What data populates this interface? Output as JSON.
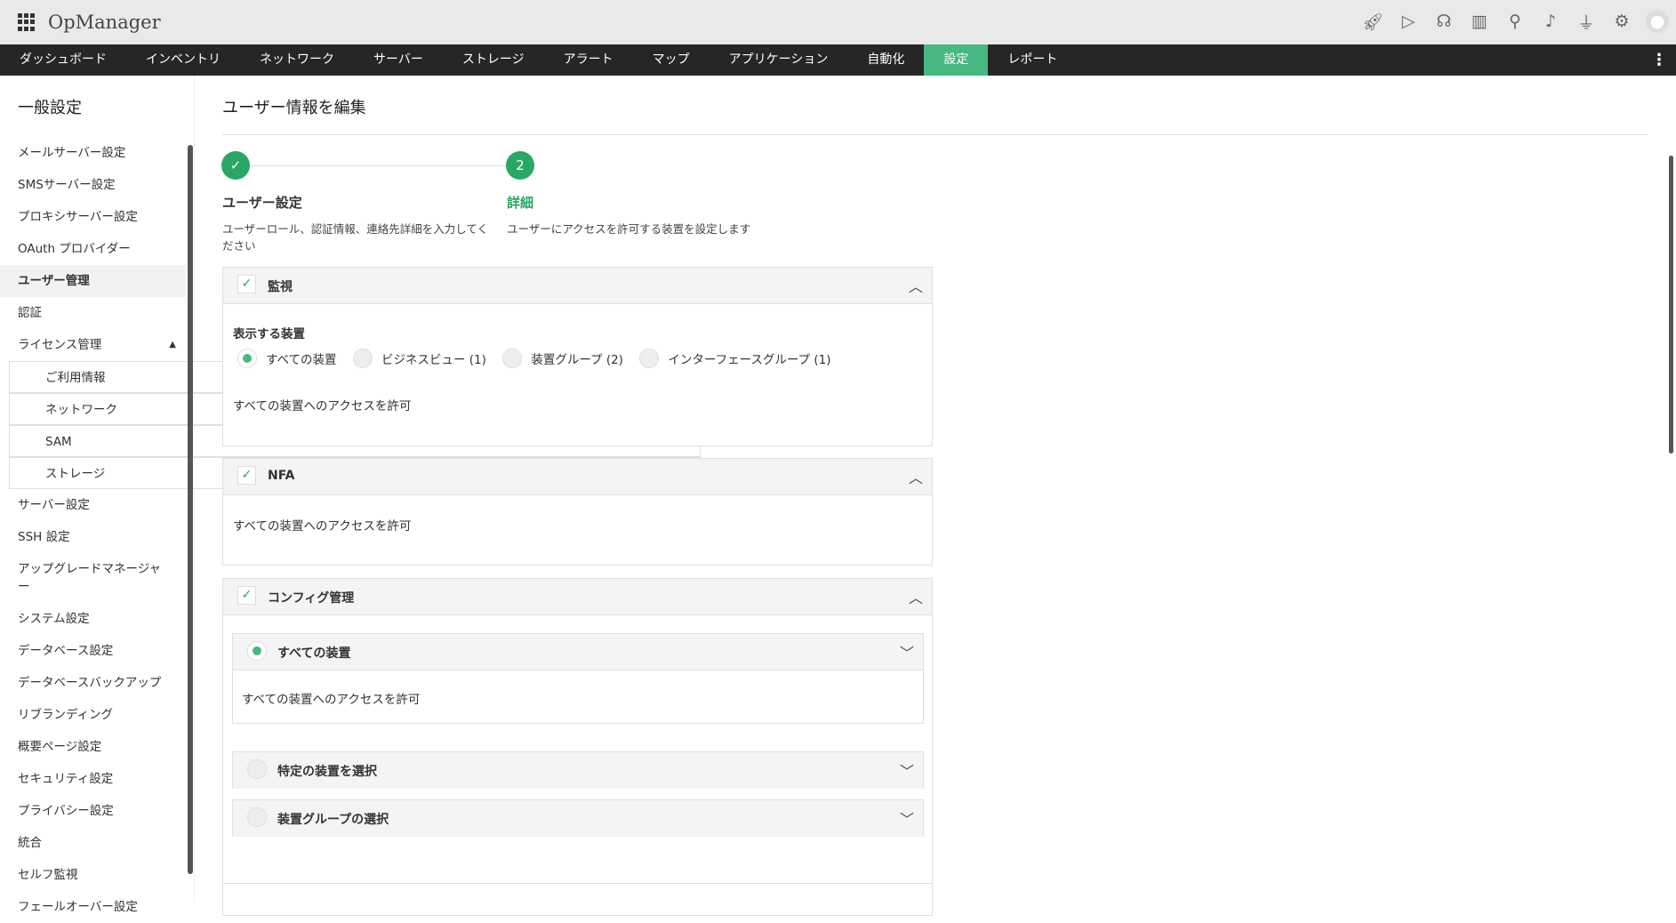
{
  "app": {
    "title": "OpManager"
  },
  "top_icons": [
    "rocket-icon",
    "presentation-icon",
    "headset-icon",
    "gift-icon",
    "search-icon",
    "bell-icon",
    "plug-icon",
    "gear-icon",
    "avatar-icon"
  ],
  "nav": [
    "ダッシュボード",
    "インベントリ",
    "ネットワーク",
    "サーバー",
    "ストレージ",
    "アラート",
    "マップ",
    "アプリケーション",
    "自動化",
    "設定",
    "レポート"
  ],
  "nav_active": "設定",
  "sidebar": {
    "title": "一般設定",
    "items": [
      "メールサーバー設定",
      "SMSサーバー設定",
      "プロキシサーバー設定",
      "OAuth プロバイダー",
      "ユーザー管理",
      "認証",
      "ライセンス管理",
      "ご利用情報",
      "ネットワーク",
      "SAM",
      "ストレージ",
      "サーバー設定",
      "SSH 設定",
      "アップグレードマネージャー",
      "システム設定",
      "データベース設定",
      "データベースバックアップ",
      "リブランディング",
      "概要ページ設定",
      "セキュリティ設定",
      "プライバシー設定",
      "統合",
      "セルフ監視",
      "フェールオーバー設定"
    ]
  },
  "page": {
    "title": "ユーザー情報を編集"
  },
  "steps": [
    {
      "label": "ユーザー設定",
      "desc": "ユーザーロール、認証情報、連絡先詳細を入力してください",
      "status": "done",
      "mark": "✓"
    },
    {
      "label": "詳細",
      "desc": "ユーザーにアクセスを許可する装置を設定します",
      "status": "active",
      "mark": "2"
    }
  ],
  "panels": {
    "monitor": {
      "title": "監視",
      "devices_label": "表示する装置",
      "options": [
        "すべての装置",
        "ビジネスビュー (1)",
        "装置グループ (2)",
        "インターフェースグループ (1)"
      ],
      "selected": "すべての装置",
      "note": "すべての装置へのアクセスを許可"
    },
    "nfa": {
      "title": "NFA",
      "note": "すべての装置へのアクセスを許可"
    },
    "config": {
      "title": "コンフィグ管理",
      "subs": [
        {
          "title": "すべての装置",
          "note": "すべての装置へのアクセスを許可",
          "selected": true
        },
        {
          "title": "特定の装置を選択"
        },
        {
          "title": "装置グループの選択"
        }
      ]
    }
  },
  "colors": {
    "accent": "#47b881",
    "step": "#2aa764",
    "nav_bg": "#262626"
  }
}
